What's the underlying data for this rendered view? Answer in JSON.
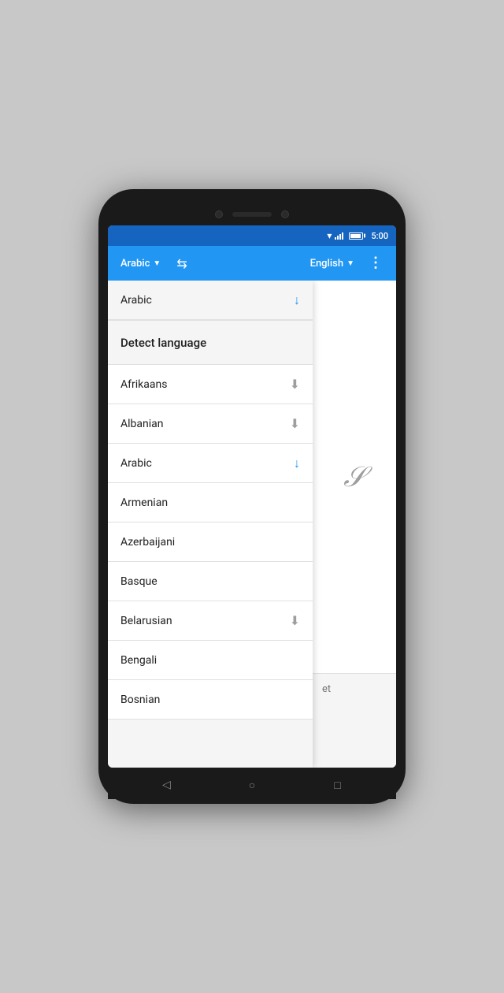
{
  "statusBar": {
    "time": "5:00"
  },
  "toolbar": {
    "sourceLang": "Arabic",
    "targetLang": "English",
    "swapLabel": "⇆",
    "moreLabel": "⋮"
  },
  "dropdown": {
    "items": [
      {
        "id": "arabic-selected",
        "label": "Arabic",
        "download": "spinning",
        "selected": true
      },
      {
        "id": "detect",
        "label": "Detect language",
        "download": "none",
        "detect": true
      },
      {
        "id": "afrikaans",
        "label": "Afrikaans",
        "download": "available"
      },
      {
        "id": "albanian",
        "label": "Albanian",
        "download": "available"
      },
      {
        "id": "arabic",
        "label": "Arabic",
        "download": "spinning"
      },
      {
        "id": "armenian",
        "label": "Armenian",
        "download": "none"
      },
      {
        "id": "azerbaijani",
        "label": "Azerbaijani",
        "download": "none"
      },
      {
        "id": "basque",
        "label": "Basque",
        "download": "none"
      },
      {
        "id": "belarusian",
        "label": "Belarusian",
        "download": "available"
      },
      {
        "id": "bengali",
        "label": "Bengali",
        "download": "none"
      },
      {
        "id": "bosnian",
        "label": "Bosnian",
        "download": "none"
      }
    ]
  },
  "rightContent": {
    "handwriteSymbol": "𝒮",
    "outputPlaceholder": "et"
  },
  "navButtons": {
    "back": "◁",
    "home": "○",
    "recent": "□"
  }
}
